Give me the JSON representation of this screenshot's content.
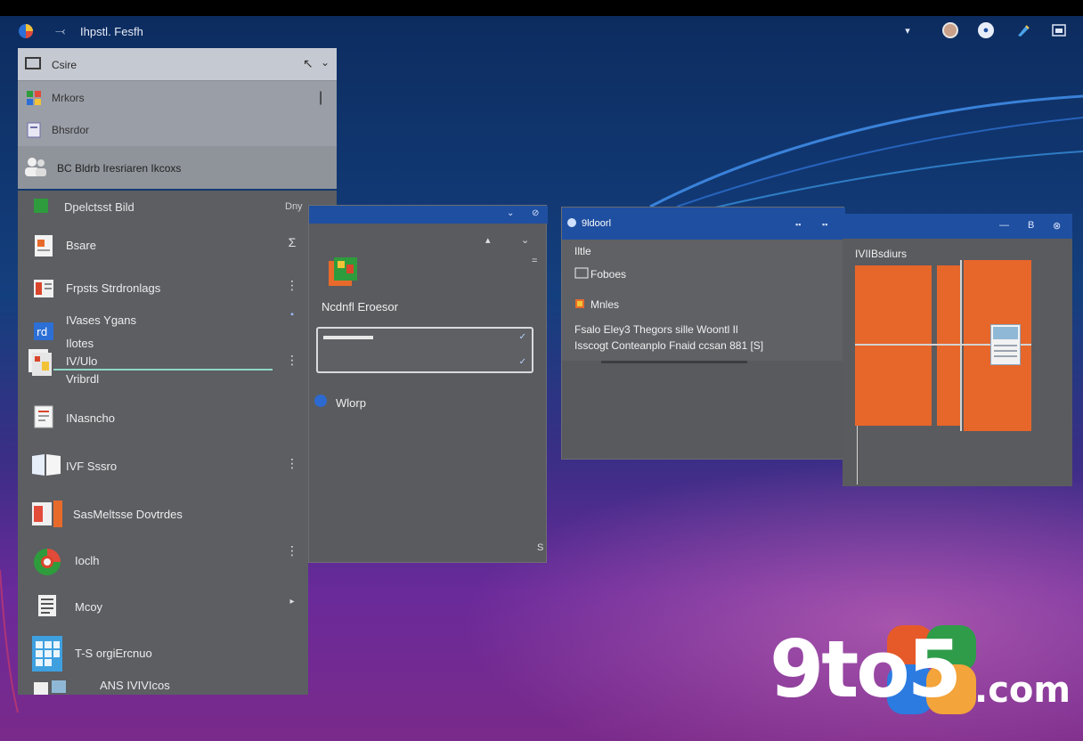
{
  "colors": {
    "taskbar_blue": "#1f4fa0",
    "panel_gray": "#5c5e62",
    "panel_light": "#c5c9d1",
    "orange_tile": "#e7662a",
    "selection_line": "#8fd6c8"
  },
  "topbar": {
    "back_glyph": "⤙",
    "title": "Ihpstl. Fesfh",
    "icons": [
      "dropdown-icon",
      "avatar-icon",
      "notification-icon",
      "pen-icon",
      "window-icon"
    ]
  },
  "start_panel": {
    "search": {
      "value": "Csire",
      "back_glyph": "↖",
      "chevron_glyph": "⌄"
    },
    "top_rows": [
      {
        "label": "Mrkors",
        "icon": "apps-icon",
        "aux": "|"
      },
      {
        "label": "Bhsrdor",
        "icon": "reader-icon"
      }
    ],
    "mid_row": {
      "label": "BC Bldrb Iresriaren Ikcoxs",
      "icon": "people-icon"
    },
    "pinned": {
      "label": "Dpelctsst Bild",
      "aux": "Dny"
    },
    "items": [
      {
        "label": "Bsare",
        "icon": "document-icon",
        "more": "Σ"
      },
      {
        "label": "Frpsts Strdronlags",
        "icon": "presentation-icon",
        "more": "⋮"
      },
      {
        "label": "IVases Ygans",
        "icon": "word-icon",
        "more": "▪",
        "sub": [
          "Ilotes",
          "IV/Ulo",
          "Vribrdl"
        ]
      },
      {
        "label": "INasncho",
        "icon": "notes-icon",
        "more": ""
      },
      {
        "label": "IVF Sssro",
        "icon": "file-icon",
        "more": "⋮"
      },
      {
        "label": "SasMeltsse Dovtrdes",
        "icon": "slides-icon",
        "more": ""
      },
      {
        "label": "Ioclh",
        "icon": "browser-icon",
        "more": "⋮"
      },
      {
        "label": "Mcoy",
        "icon": "note-icon",
        "more": "▸"
      },
      {
        "label": "T-S orgiErcnuo",
        "icon": "calendar-icon",
        "more": ""
      },
      {
        "label": "ANS IVIVIcos",
        "icon": "monitor-icon",
        "more": ""
      }
    ]
  },
  "dialog": {
    "header_controls": [
      "⌄",
      "⊘"
    ],
    "toolbar": [
      "▴",
      "⌄",
      "="
    ],
    "title": "Ncdnfl Eroesor",
    "field_checks": [
      "✓",
      "✓"
    ],
    "more_label": "Wlorp",
    "corner_glyph": "S"
  },
  "window2": {
    "title": "9ldoorl",
    "controls": [
      "▪▪",
      "▪▪"
    ],
    "lines": [
      "Iltle",
      "Foboes",
      "Mnles",
      "Fsalo Eley3 Thegors sille Woontl Il",
      "Isscogt Conteanplo Fnaid ccsan 881 [S]"
    ]
  },
  "window3": {
    "controls": [
      "—",
      "B",
      "⊗"
    ],
    "title": "IVIIBsdiurs"
  },
  "logo": {
    "text": "9to5",
    "suffix": ".com"
  }
}
